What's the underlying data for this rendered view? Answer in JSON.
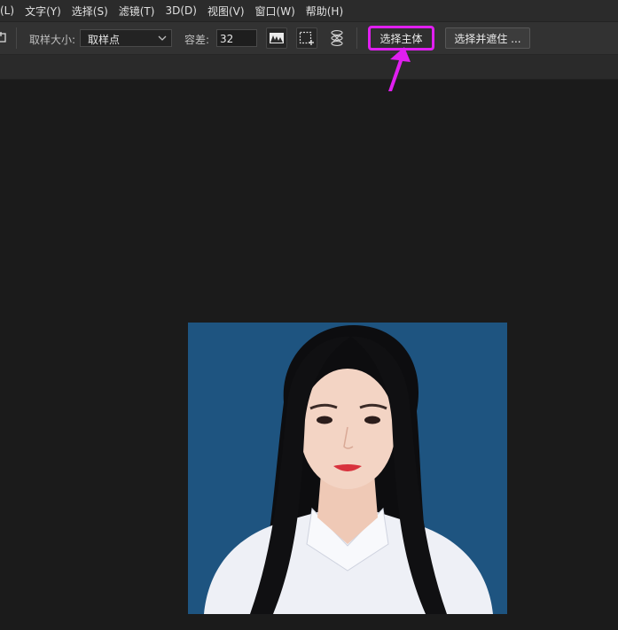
{
  "menubar": {
    "items": [
      "(L)",
      "文字(Y)",
      "选择(S)",
      "滤镜(T)",
      "3D(D)",
      "视图(V)",
      "窗口(W)",
      "帮助(H)"
    ]
  },
  "options": {
    "sample_size_label": "取样大小:",
    "sample_size_value": "取样点",
    "tolerance_label": "容差:",
    "tolerance_value": "32",
    "select_subject_label": "选择主体",
    "select_and_mask_label": "选择并遮住 ..."
  },
  "highlight_color": "#e01ff0",
  "photo_background_color": "#1e5480"
}
